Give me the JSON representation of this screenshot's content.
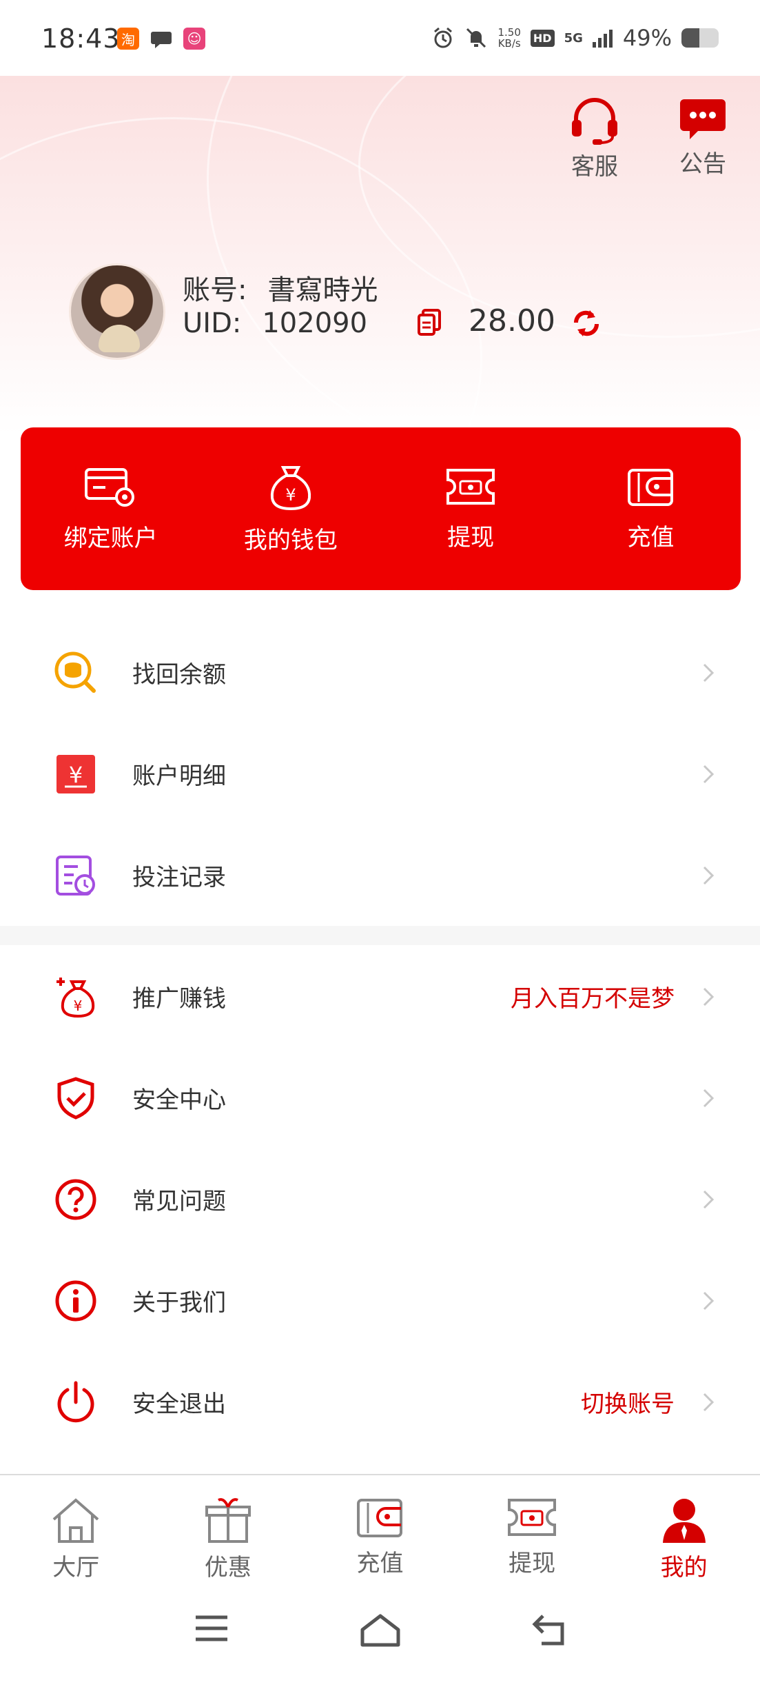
{
  "status_bar": {
    "time": "18:43",
    "net_speed_value": "1.50",
    "net_speed_unit": "KB/s",
    "hd": "HD",
    "signal": "5G",
    "battery_pct": "49%",
    "battery_level": 0.49
  },
  "header": {
    "customer_service_label": "客服",
    "notice_label": "公告",
    "account_key": "账号:",
    "account_value": "書寫時光",
    "uid_key": "UID:",
    "uid_value": "102090",
    "balance": "28.00"
  },
  "actions": [
    {
      "label": "绑定账户"
    },
    {
      "label": "我的钱包"
    },
    {
      "label": "提现"
    },
    {
      "label": "充值"
    }
  ],
  "menu_group_1": [
    {
      "label": "找回余额",
      "hint": ""
    },
    {
      "label": "账户明细",
      "hint": ""
    },
    {
      "label": "投注记录",
      "hint": ""
    }
  ],
  "menu_group_2": [
    {
      "label": "推广赚钱",
      "hint": "月入百万不是梦"
    },
    {
      "label": "安全中心",
      "hint": ""
    },
    {
      "label": "常见问题",
      "hint": ""
    },
    {
      "label": "关于我们",
      "hint": ""
    },
    {
      "label": "安全退出",
      "hint": "切换账号"
    }
  ],
  "bottom_nav": [
    {
      "label": "大厅",
      "icon": "home-icon"
    },
    {
      "label": "优惠",
      "icon": "gift-icon"
    },
    {
      "label": "充值",
      "icon": "wallet-icon"
    },
    {
      "label": "提现",
      "icon": "ticket-icon"
    },
    {
      "label": "我的",
      "icon": "user-icon",
      "active": true
    }
  ],
  "colors": {
    "accent": "#ee0000",
    "hint_red": "#d40000"
  }
}
